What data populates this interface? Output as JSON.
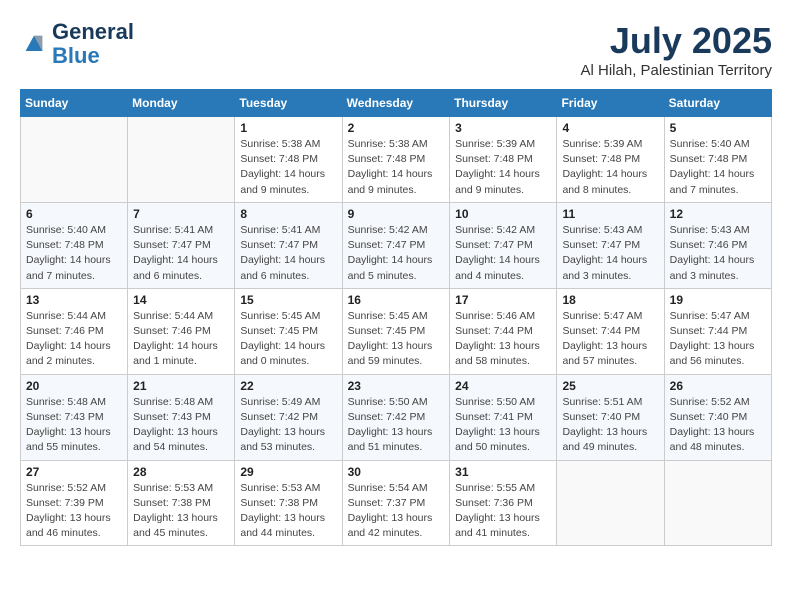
{
  "header": {
    "logo_line1": "General",
    "logo_line2": "Blue",
    "main_title": "July 2025",
    "subtitle": "Al Hilah, Palestinian Territory"
  },
  "days_of_week": [
    "Sunday",
    "Monday",
    "Tuesday",
    "Wednesday",
    "Thursday",
    "Friday",
    "Saturday"
  ],
  "weeks": [
    [
      {
        "day": "",
        "info": ""
      },
      {
        "day": "",
        "info": ""
      },
      {
        "day": "1",
        "info": "Sunrise: 5:38 AM\nSunset: 7:48 PM\nDaylight: 14 hours\nand 9 minutes."
      },
      {
        "day": "2",
        "info": "Sunrise: 5:38 AM\nSunset: 7:48 PM\nDaylight: 14 hours\nand 9 minutes."
      },
      {
        "day": "3",
        "info": "Sunrise: 5:39 AM\nSunset: 7:48 PM\nDaylight: 14 hours\nand 9 minutes."
      },
      {
        "day": "4",
        "info": "Sunrise: 5:39 AM\nSunset: 7:48 PM\nDaylight: 14 hours\nand 8 minutes."
      },
      {
        "day": "5",
        "info": "Sunrise: 5:40 AM\nSunset: 7:48 PM\nDaylight: 14 hours\nand 7 minutes."
      }
    ],
    [
      {
        "day": "6",
        "info": "Sunrise: 5:40 AM\nSunset: 7:48 PM\nDaylight: 14 hours\nand 7 minutes."
      },
      {
        "day": "7",
        "info": "Sunrise: 5:41 AM\nSunset: 7:47 PM\nDaylight: 14 hours\nand 6 minutes."
      },
      {
        "day": "8",
        "info": "Sunrise: 5:41 AM\nSunset: 7:47 PM\nDaylight: 14 hours\nand 6 minutes."
      },
      {
        "day": "9",
        "info": "Sunrise: 5:42 AM\nSunset: 7:47 PM\nDaylight: 14 hours\nand 5 minutes."
      },
      {
        "day": "10",
        "info": "Sunrise: 5:42 AM\nSunset: 7:47 PM\nDaylight: 14 hours\nand 4 minutes."
      },
      {
        "day": "11",
        "info": "Sunrise: 5:43 AM\nSunset: 7:47 PM\nDaylight: 14 hours\nand 3 minutes."
      },
      {
        "day": "12",
        "info": "Sunrise: 5:43 AM\nSunset: 7:46 PM\nDaylight: 14 hours\nand 3 minutes."
      }
    ],
    [
      {
        "day": "13",
        "info": "Sunrise: 5:44 AM\nSunset: 7:46 PM\nDaylight: 14 hours\nand 2 minutes."
      },
      {
        "day": "14",
        "info": "Sunrise: 5:44 AM\nSunset: 7:46 PM\nDaylight: 14 hours\nand 1 minute."
      },
      {
        "day": "15",
        "info": "Sunrise: 5:45 AM\nSunset: 7:45 PM\nDaylight: 14 hours\nand 0 minutes."
      },
      {
        "day": "16",
        "info": "Sunrise: 5:45 AM\nSunset: 7:45 PM\nDaylight: 13 hours\nand 59 minutes."
      },
      {
        "day": "17",
        "info": "Sunrise: 5:46 AM\nSunset: 7:44 PM\nDaylight: 13 hours\nand 58 minutes."
      },
      {
        "day": "18",
        "info": "Sunrise: 5:47 AM\nSunset: 7:44 PM\nDaylight: 13 hours\nand 57 minutes."
      },
      {
        "day": "19",
        "info": "Sunrise: 5:47 AM\nSunset: 7:44 PM\nDaylight: 13 hours\nand 56 minutes."
      }
    ],
    [
      {
        "day": "20",
        "info": "Sunrise: 5:48 AM\nSunset: 7:43 PM\nDaylight: 13 hours\nand 55 minutes."
      },
      {
        "day": "21",
        "info": "Sunrise: 5:48 AM\nSunset: 7:43 PM\nDaylight: 13 hours\nand 54 minutes."
      },
      {
        "day": "22",
        "info": "Sunrise: 5:49 AM\nSunset: 7:42 PM\nDaylight: 13 hours\nand 53 minutes."
      },
      {
        "day": "23",
        "info": "Sunrise: 5:50 AM\nSunset: 7:42 PM\nDaylight: 13 hours\nand 51 minutes."
      },
      {
        "day": "24",
        "info": "Sunrise: 5:50 AM\nSunset: 7:41 PM\nDaylight: 13 hours\nand 50 minutes."
      },
      {
        "day": "25",
        "info": "Sunrise: 5:51 AM\nSunset: 7:40 PM\nDaylight: 13 hours\nand 49 minutes."
      },
      {
        "day": "26",
        "info": "Sunrise: 5:52 AM\nSunset: 7:40 PM\nDaylight: 13 hours\nand 48 minutes."
      }
    ],
    [
      {
        "day": "27",
        "info": "Sunrise: 5:52 AM\nSunset: 7:39 PM\nDaylight: 13 hours\nand 46 minutes."
      },
      {
        "day": "28",
        "info": "Sunrise: 5:53 AM\nSunset: 7:38 PM\nDaylight: 13 hours\nand 45 minutes."
      },
      {
        "day": "29",
        "info": "Sunrise: 5:53 AM\nSunset: 7:38 PM\nDaylight: 13 hours\nand 44 minutes."
      },
      {
        "day": "30",
        "info": "Sunrise: 5:54 AM\nSunset: 7:37 PM\nDaylight: 13 hours\nand 42 minutes."
      },
      {
        "day": "31",
        "info": "Sunrise: 5:55 AM\nSunset: 7:36 PM\nDaylight: 13 hours\nand 41 minutes."
      },
      {
        "day": "",
        "info": ""
      },
      {
        "day": "",
        "info": ""
      }
    ]
  ]
}
